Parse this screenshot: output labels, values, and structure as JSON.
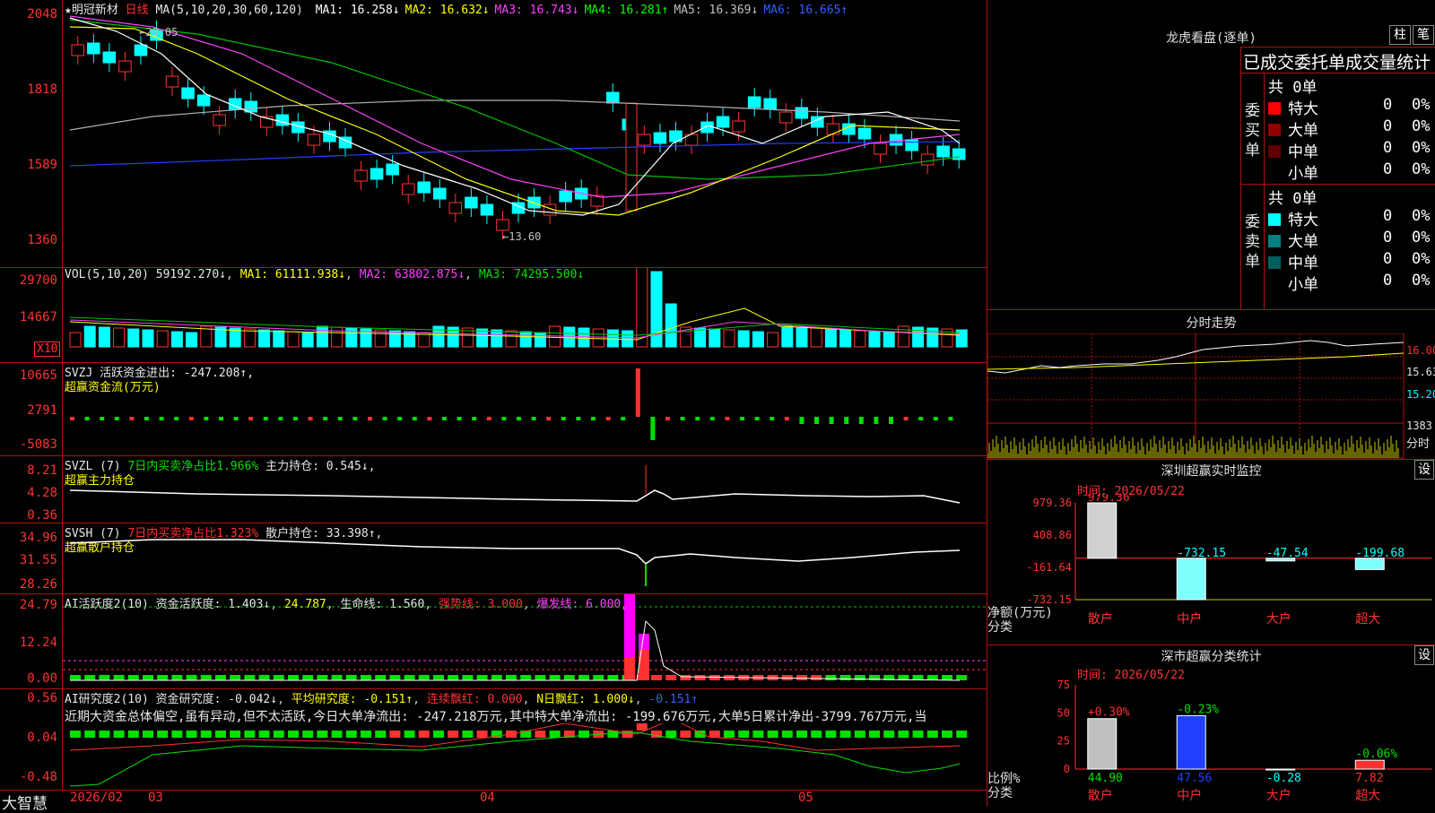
{
  "app": {
    "brand": "大智慧"
  },
  "kline": {
    "stock": "★明冠新材",
    "period": "日线",
    "ma_label": "MA(5,10,20,30,60,120)",
    "ma": [
      {
        "name": "MA1:",
        "value": "16.258↓",
        "color": "#ffffff"
      },
      {
        "name": "MA2:",
        "value": "16.632↓",
        "color": "#ffff00"
      },
      {
        "name": "MA3:",
        "value": "16.743↓",
        "color": "#ff40ff"
      },
      {
        "name": "MA4:",
        "value": "16.281↑",
        "color": "#00ff00"
      },
      {
        "name": "MA5:",
        "value": "16.369↓",
        "color": "#c0c0c0"
      },
      {
        "name": "MA6:",
        "value": "16.665↑",
        "color": "#3060ff"
      }
    ],
    "yticks": [
      "2048",
      "1818",
      "1589",
      "1360"
    ],
    "high_label": "20.05",
    "low_label": "←13.60"
  },
  "vol": {
    "label": "VOL(5,10,20)",
    "value": "59192.270↓",
    "ma1": "MA1: 61111.938↓",
    "ma2": "MA2: 63802.875↓",
    "ma3": "MA3: 74295.500↓",
    "yticks": [
      "29700",
      "14667"
    ],
    "unit": "X10"
  },
  "svzj": {
    "label": "SVZJ",
    "line": "活跃资金进出: -247.208↑,",
    "sub": "超赢资金流(万元)",
    "yticks": [
      "10665",
      "2791",
      "-5083"
    ]
  },
  "svzl": {
    "label": "SVZL (7)",
    "p1": "7日内买卖净占比1.966%",
    "p2": "主力持仓: 0.545↓,",
    "sub": "超赢主力持仓",
    "yticks": [
      "8.21",
      "4.28",
      "0.36"
    ]
  },
  "svsh": {
    "label": "SVSH (7)",
    "p1": "7日内买卖净占比1.323%",
    "p2": "散户持仓: 33.398↑,",
    "sub": "超赢散户持仓",
    "yticks": [
      "34.96",
      "31.55",
      "28.26"
    ]
  },
  "ai1": {
    "label": "AI活跃度2(10)",
    "p1": "资金活跃度: 1.403↓",
    "p2": "24.787",
    "p3": "生命线: 1.560",
    "p4": "强势线: 3.000",
    "p5": "爆发线: 6.000",
    "yticks": [
      "24.79",
      "12.24",
      "0.00"
    ]
  },
  "ai2": {
    "label": "AI研究度2(10)",
    "p1": "资金研究度: -0.042↓",
    "p2": "平均研究度: -0.151↑",
    "p3": "连续飘红: 0.000",
    "p4": "N日飘红: 1.000↓",
    "p5": "-0.151↑",
    "desc": "近期大资金总体偏空,虽有异动,但不太活跃,今日大单净流出: -247.218万元,其中特大单净流出: -199.676万元,大单5日累计净出-3799.767万元,当",
    "yticks": [
      "0.56",
      "0.04",
      "-0.48"
    ]
  },
  "xaxis": [
    "2026/02",
    "03",
    "04",
    "05"
  ],
  "longhu": {
    "title": "龙虎看盘(逐单)",
    "btn1": "柱",
    "btn2": "笔",
    "header": "已成交委托单成交量统计",
    "buy_label": "委买单",
    "sell_label": "委卖单",
    "buy_total": "共 0单",
    "sell_total": "共 0单",
    "buy_rows": [
      {
        "name": "特大",
        "count": "0",
        "pct": "0%",
        "color": "#ff0000"
      },
      {
        "name": "大单",
        "count": "0",
        "pct": "0%",
        "color": "#900000"
      },
      {
        "name": "中单",
        "count": "0",
        "pct": "0%",
        "color": "#600000"
      },
      {
        "name": "小单",
        "count": "0",
        "pct": "0%",
        "color": "#000000"
      }
    ],
    "sell_rows": [
      {
        "name": "特大",
        "count": "0",
        "pct": "0%",
        "color": "#00ffff"
      },
      {
        "name": "大单",
        "count": "0",
        "pct": "0%",
        "color": "#008080"
      },
      {
        "name": "中单",
        "count": "0",
        "pct": "0%",
        "color": "#006060"
      },
      {
        "name": "小单",
        "count": "0",
        "pct": "0%",
        "color": "#000000"
      }
    ]
  },
  "intraday": {
    "title": "分时走势",
    "yticks": [
      "16.00",
      "15.63",
      "15.20"
    ],
    "vol": "1383",
    "unit": "分时"
  },
  "sz_monitor": {
    "title": "深圳超赢实时监控",
    "btn": "设",
    "time": "时间: 2026/05/22",
    "yticks": [
      "979.36",
      "408.86",
      "-161.64",
      "-732.15"
    ],
    "ylabel1": "净额(万元)",
    "ylabel2": "分类",
    "bars": [
      {
        "cat": "散户",
        "value": 979.36,
        "label": "979.36"
      },
      {
        "cat": "中户",
        "value": -732.15,
        "label": "-732.15"
      },
      {
        "cat": "大户",
        "value": -47.54,
        "label": "-47.54"
      },
      {
        "cat": "超大",
        "value": -199.68,
        "label": "-199.68"
      }
    ]
  },
  "sz_class": {
    "title": "深市超赢分类统计",
    "btn": "设",
    "time": "时间: 2026/05/22",
    "yticks": [
      "75",
      "50",
      "25",
      "0"
    ],
    "ylabel1": "比例%",
    "ylabel2": "分类",
    "bars": [
      {
        "cat": "散户",
        "value": 44.9,
        "label": "44.90",
        "delta": "+0.30%"
      },
      {
        "cat": "中户",
        "value": 47.56,
        "label": "47.56",
        "delta": "-0.23%"
      },
      {
        "cat": "大户",
        "value": -0.28,
        "label": "-0.28",
        "delta": ""
      },
      {
        "cat": "超大",
        "value": 7.82,
        "label": "7.82",
        "delta": "-0.06%"
      }
    ]
  }
}
